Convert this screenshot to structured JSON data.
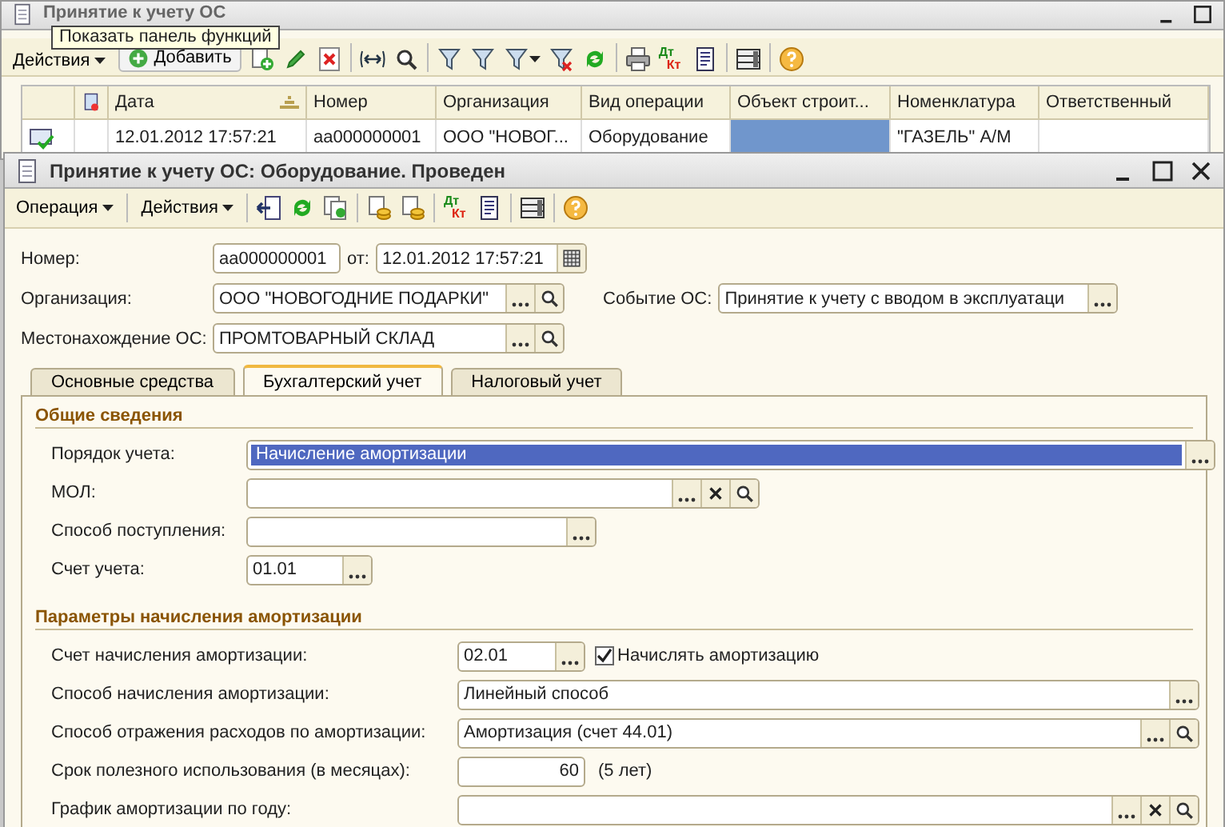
{
  "back_window": {
    "title": "Принятие к учету ОС",
    "actions_menu": "Действия",
    "add_button": "Добавить",
    "dtkt": {
      "debit": "Дт",
      "credit": "Кт"
    },
    "table": {
      "columns": [
        {
          "kind": "icon"
        },
        {
          "kind": "status"
        },
        {
          "kind": "text",
          "label": "Дата",
          "sorted": true
        },
        {
          "kind": "text",
          "label": "Номер",
          "sorted": false
        },
        {
          "kind": "text",
          "label": "Организация",
          "sorted": false
        },
        {
          "kind": "text",
          "label": "Вид операции",
          "sorted": false
        },
        {
          "kind": "text",
          "label": "Объект строит...",
          "sorted": false
        },
        {
          "kind": "text",
          "label": "Номенклатура",
          "sorted": false
        },
        {
          "kind": "text",
          "label": "Ответственный",
          "sorted": false
        }
      ],
      "rows": [
        {
          "cells": [
            {
              "posted": true,
              "selected": false
            },
            {
              "selected": false
            },
            {
              "text": "12.01.2012 17:57:21",
              "selected": false
            },
            {
              "text": "аа000000001",
              "selected": false
            },
            {
              "text": "ООО \"НОВОГ...",
              "selected": false
            },
            {
              "text": "Оборудование",
              "selected": false
            },
            {
              "selected": true
            },
            {
              "text": "\"ГАЗЕЛЬ\" А/М",
              "selected": false
            },
            {
              "selected": false
            }
          ]
        }
      ]
    }
  },
  "tooltip": "Показать панель функций",
  "document_window": {
    "title": "Принятие к учету ОС: Оборудование. Проведен",
    "menus": [
      "Операция",
      "Действия"
    ],
    "dtkt": {
      "debit": "Дт",
      "credit": "Кт"
    },
    "header": [
      [
        {
          "kind": "label",
          "text": "Номер:"
        },
        {
          "kind": "plain",
          "value": "аа000000001"
        },
        {
          "kind": "label",
          "text": "от:"
        },
        {
          "kind": "date",
          "value": "12.01.2012 17:57:21"
        }
      ],
      [
        {
          "kind": "label",
          "text": "Организация:"
        },
        {
          "kind": "reference",
          "value": "ООО \"НОВОГОДНИЕ ПОДАРКИ\""
        },
        {
          "kind": "label",
          "text": "Событие ОС:"
        },
        {
          "kind": "choice",
          "value": "Принятие к учету с вводом в эксплуатаци"
        }
      ],
      [
        {
          "kind": "label",
          "text": "Местонахождение ОС:"
        },
        {
          "kind": "reference",
          "value": "ПРОМТОВАРНЫЙ СКЛАД"
        }
      ]
    ],
    "tabs": [
      {
        "label": "Основные средства",
        "selected": false
      },
      {
        "label": "Бухгалтерский учет",
        "selected": true
      },
      {
        "label": "Налоговый учет",
        "selected": false
      }
    ],
    "sections": [
      {
        "title": "Общие сведения",
        "fields": [
          {
            "kind": "choice",
            "label": "Порядок учета:",
            "value": "Начисление амортизации",
            "selected": true
          },
          {
            "kind": "clearable",
            "label": "МОЛ:",
            "selected": false
          },
          {
            "kind": "choice",
            "label": "Способ поступления:",
            "selected": false
          },
          {
            "kind": "choice",
            "label": "Счет учета:",
            "value": "01.01",
            "selected": false
          }
        ]
      },
      {
        "title": "Параметры начисления амортизации",
        "fields": [
          {
            "kind": "choice",
            "label": "Счет начисления амортизации:",
            "value": "02.01",
            "selected": false,
            "checkbox": {
              "label": "Начислять амортизацию",
              "checked": true
            }
          },
          {
            "kind": "choice",
            "label": "Способ начисления амортизации:",
            "value": "Линейный способ",
            "selected": false
          },
          {
            "kind": "reference",
            "label": "Способ отражения расходов по амортизации:",
            "value": "Амортизация (счет 44.01)",
            "selected": false
          },
          {
            "kind": "number",
            "label": "Срок полезного использования (в месяцах):",
            "value": "60",
            "selected": false,
            "note": "(5 лет)"
          },
          {
            "kind": "clearable",
            "label": "График амортизации по году:",
            "selected": false
          }
        ]
      }
    ]
  }
}
